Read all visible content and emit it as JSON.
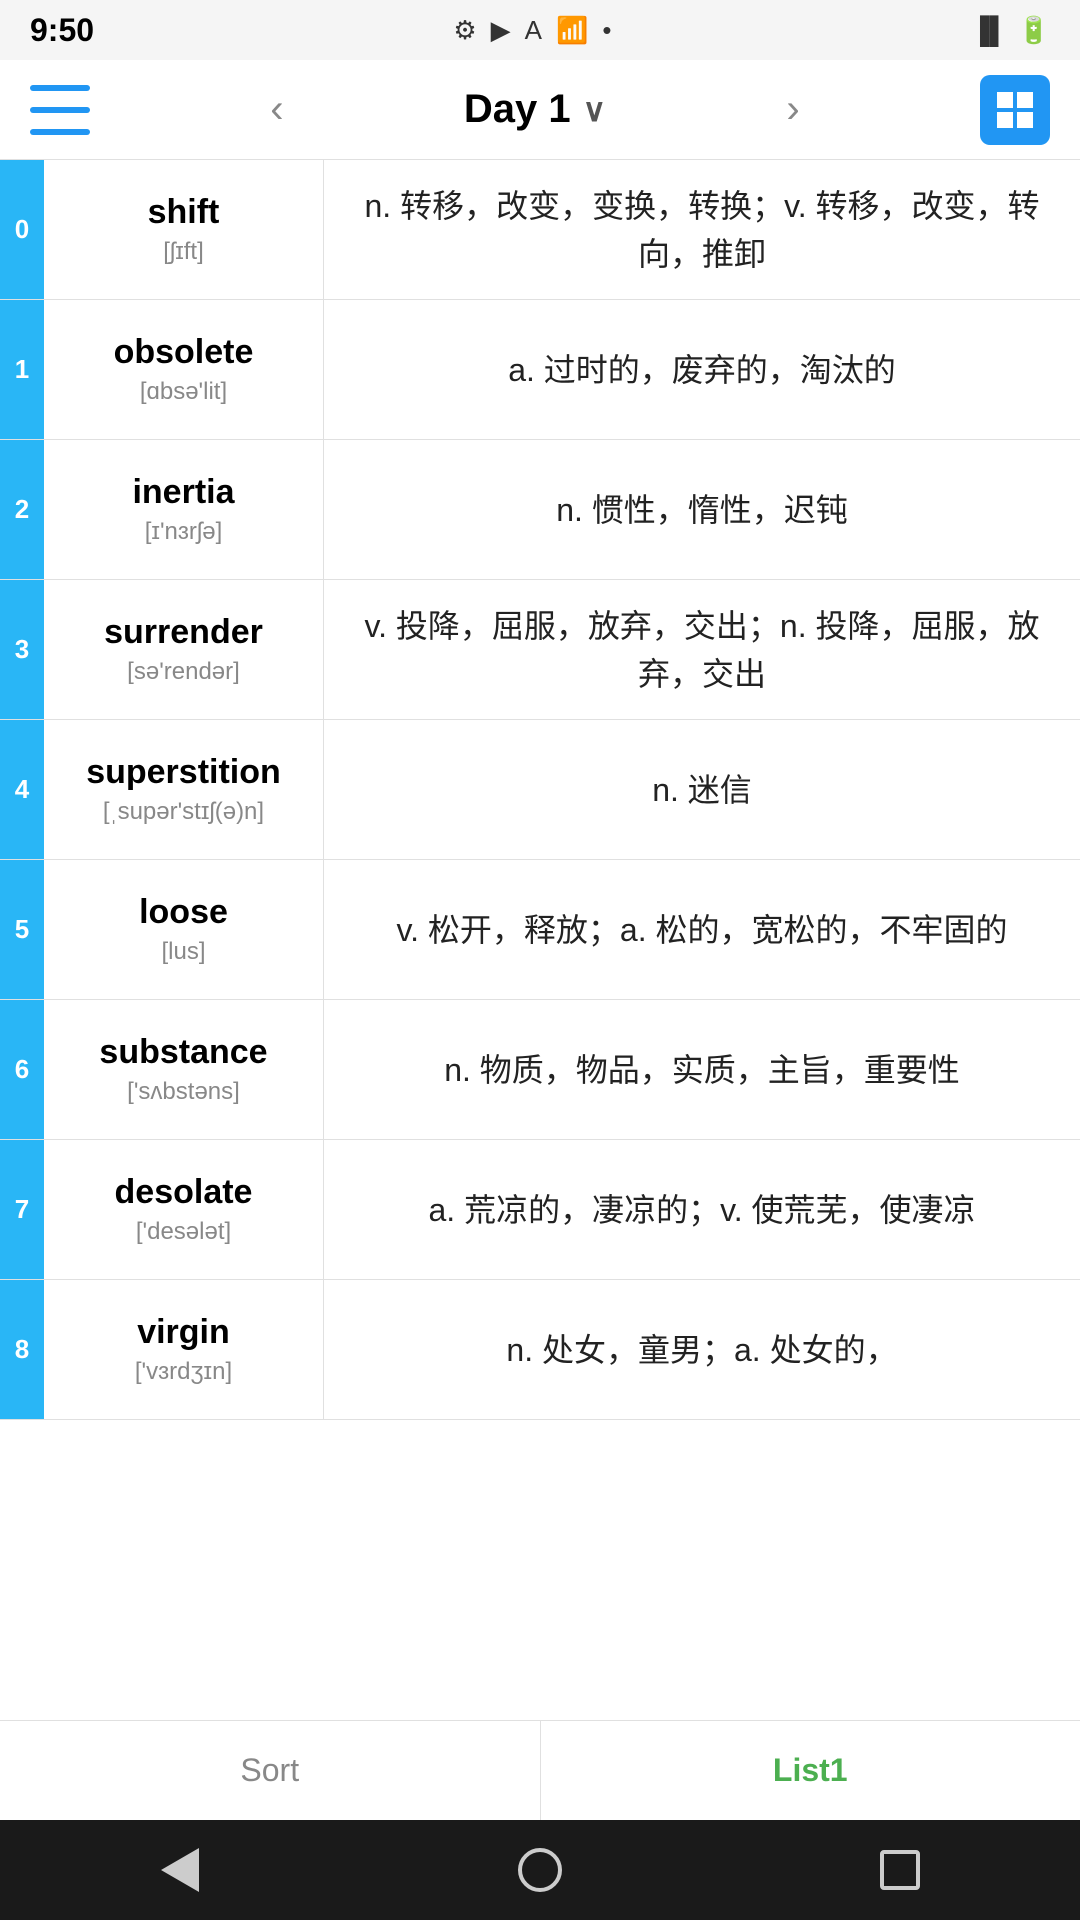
{
  "statusBar": {
    "time": "9:50",
    "icons": [
      "⚙",
      "▶",
      "A",
      "?",
      "•"
    ]
  },
  "navBar": {
    "title": "Day 1",
    "prevArrow": "‹",
    "nextArrow": "›"
  },
  "words": [
    {
      "index": "0",
      "word": "shift",
      "phonetic": "[ʃɪft]",
      "definition": "n. 转移，改变，变换，转换；v. 转移，改变，转向，推卸"
    },
    {
      "index": "1",
      "word": "obsolete",
      "phonetic": "[ɑbsə'lit]",
      "definition": "a. 过时的，废弃的，淘汰的"
    },
    {
      "index": "2",
      "word": "inertia",
      "phonetic": "[ɪ'nɜrʃə]",
      "definition": "n. 惯性，惰性，迟钝"
    },
    {
      "index": "3",
      "word": "surrender",
      "phonetic": "[sə'rendər]",
      "definition": "v. 投降，屈服，放弃，交出；n. 投降，屈服，放弃，交出"
    },
    {
      "index": "4",
      "word": "superstition",
      "phonetic": "[ˌsupər'stɪʃ(ə)n]",
      "definition": "n. 迷信"
    },
    {
      "index": "5",
      "word": "loose",
      "phonetic": "[lus]",
      "definition": "v. 松开，释放；a. 松的，宽松的，不牢固的"
    },
    {
      "index": "6",
      "word": "substance",
      "phonetic": "['sʌbstəns]",
      "definition": "n. 物质，物品，实质，主旨，重要性"
    },
    {
      "index": "7",
      "word": "desolate",
      "phonetic": "['desələt]",
      "definition": "a. 荒凉的，凄凉的；v. 使荒芜，使凄凉"
    },
    {
      "index": "8",
      "word": "virgin",
      "phonetic": "['vɜrdʒɪn]",
      "definition": "n. 处女，童男；a. 处女的，"
    }
  ],
  "bottomTabs": {
    "sort": "Sort",
    "list1": "List1"
  },
  "androidNav": {
    "back": "back",
    "home": "home",
    "recent": "recent"
  }
}
